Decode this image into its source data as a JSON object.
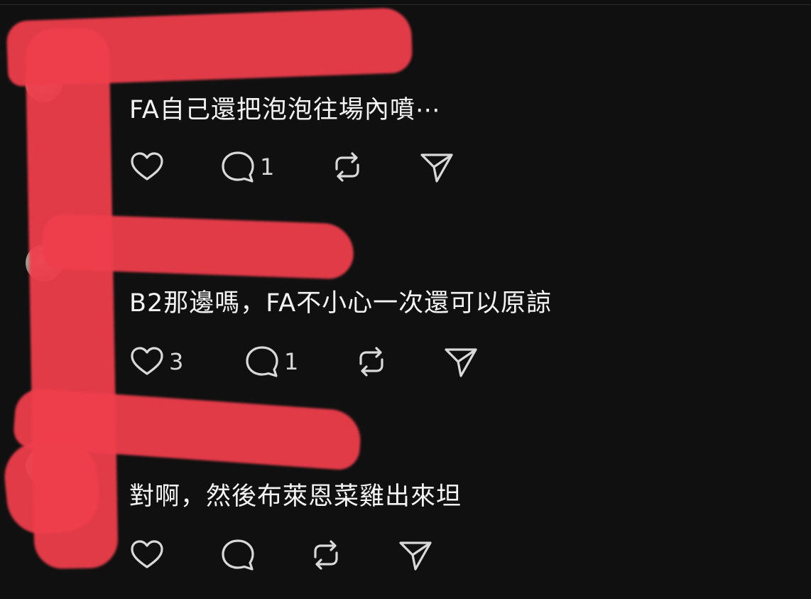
{
  "posts": [
    {
      "username": "",
      "time": "",
      "text": "FA自己還把泡泡往場內噴⋯",
      "likes": "",
      "replies": "1",
      "reposts": "",
      "shares": ""
    },
    {
      "username": "",
      "time": "",
      "text": "B2那邊嗎，FA不小心一次還可以原諒",
      "likes": "3",
      "replies": "1",
      "reposts": "",
      "shares": ""
    },
    {
      "username": "",
      "time": "",
      "text": "對啊，然後布萊恩菜雞出來坦",
      "likes": "",
      "replies": "",
      "reposts": "",
      "shares": ""
    }
  ],
  "icons": {
    "like": "heart-icon",
    "reply": "comment-icon",
    "repost": "repost-icon",
    "share": "send-icon"
  },
  "colors": {
    "background": "#101010",
    "text": "#f4f4f4",
    "icon": "#d9d9d9",
    "redaction": "#ef3e4c"
  }
}
